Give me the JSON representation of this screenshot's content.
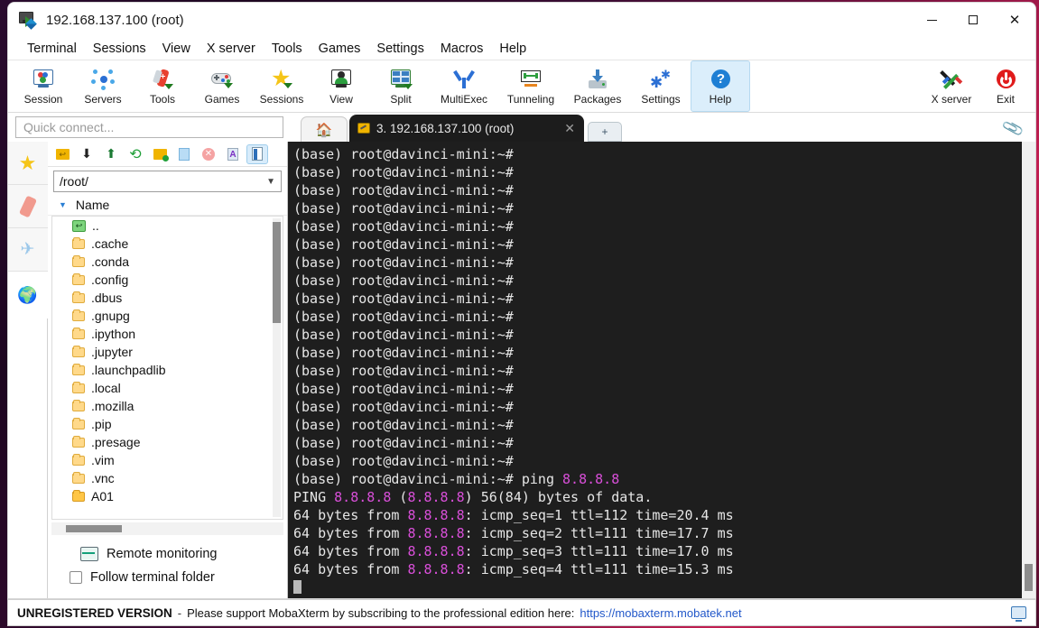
{
  "window": {
    "title": "192.168.137.100 (root)",
    "icon": "mobaxterm-icon",
    "controls": {
      "minimize": "–",
      "maximize": "□",
      "close": "✕"
    }
  },
  "menu": {
    "items": [
      "Terminal",
      "Sessions",
      "View",
      "X server",
      "Tools",
      "Games",
      "Settings",
      "Macros",
      "Help"
    ]
  },
  "toolbar": {
    "buttons": [
      {
        "label": "Session",
        "icon": "session-monitor-icon"
      },
      {
        "label": "Servers",
        "icon": "servers-network-icon"
      },
      {
        "label": "Tools",
        "icon": "tools-knife-icon"
      },
      {
        "label": "Games",
        "icon": "gamepad-icon"
      },
      {
        "label": "Sessions",
        "icon": "star-icon"
      },
      {
        "label": "View",
        "icon": "view-monitor-icon"
      },
      {
        "label": "Split",
        "icon": "split-screen-icon"
      },
      {
        "label": "MultiExec",
        "icon": "multiexec-fork-icon"
      },
      {
        "label": "Tunneling",
        "icon": "tunneling-icon"
      },
      {
        "label": "Packages",
        "icon": "packages-download-icon"
      },
      {
        "label": "Settings",
        "icon": "gear-icon"
      },
      {
        "label": "Help",
        "icon": "help-question-icon",
        "active": true
      }
    ],
    "right_buttons": [
      {
        "label": "X server",
        "icon": "x-server-icon"
      },
      {
        "label": "Exit",
        "icon": "power-exit-icon"
      }
    ]
  },
  "quick_connect": {
    "placeholder": "Quick connect..."
  },
  "tabs": {
    "home_icon": "home-icon",
    "active": {
      "label": "3. 192.168.137.100 (root)",
      "icon": "pencil-icon",
      "close": "✕"
    },
    "new_tab": "+",
    "clip_icon": "paperclip-icon"
  },
  "rail": {
    "items": [
      {
        "icon": "star-icon",
        "name": "sessions-rail"
      },
      {
        "icon": "tools-knife-icon",
        "name": "tools-rail"
      },
      {
        "icon": "paper-plane-icon",
        "name": "macros-rail"
      },
      {
        "icon": "globe-icon",
        "name": "sftp-globe-rail"
      }
    ]
  },
  "sftp": {
    "toolbar_icons": [
      "parent-folder-icon",
      "download-icon",
      "upload-icon",
      "refresh-icon",
      "new-folder-icon",
      "new-file-icon",
      "delete-icon",
      "text-mode-icon",
      "view-mode-icon"
    ],
    "path": "/root/",
    "path_chevron": "chevron-down-icon",
    "column_header": "Name",
    "sort_caret": "▼",
    "files": [
      {
        "name": "..",
        "type": "parent"
      },
      {
        "name": ".cache",
        "type": "folder"
      },
      {
        "name": ".conda",
        "type": "folder"
      },
      {
        "name": ".config",
        "type": "folder"
      },
      {
        "name": ".dbus",
        "type": "folder"
      },
      {
        "name": ".gnupg",
        "type": "folder"
      },
      {
        "name": ".ipython",
        "type": "folder"
      },
      {
        "name": ".jupyter",
        "type": "folder"
      },
      {
        "name": ".launchpadlib",
        "type": "folder"
      },
      {
        "name": ".local",
        "type": "folder"
      },
      {
        "name": ".mozilla",
        "type": "folder"
      },
      {
        "name": ".pip",
        "type": "folder"
      },
      {
        "name": ".presage",
        "type": "folder"
      },
      {
        "name": ".vim",
        "type": "folder"
      },
      {
        "name": ".vnc",
        "type": "folder"
      },
      {
        "name": "A01",
        "type": "folder-solid"
      }
    ],
    "remote_monitoring_label": "Remote monitoring",
    "follow_terminal_label": "Follow terminal folder",
    "follow_terminal_checked": false
  },
  "terminal": {
    "prompt": "(base) root@davinci-mini:~#",
    "blank_prompt_count": 18,
    "colors": {
      "background": "#1e1e1e",
      "foreground": "#e6e6e6",
      "ip_magenta": "#d94fd9"
    },
    "lines": [
      {
        "segments": [
          {
            "t": "(base) root@davinci-mini:~# ping ",
            "c": "def"
          },
          {
            "t": "8.8.8.8",
            "c": "ip"
          }
        ]
      },
      {
        "segments": [
          {
            "t": "PING ",
            "c": "def"
          },
          {
            "t": "8.8.8.8",
            "c": "ip"
          },
          {
            "t": " (",
            "c": "def"
          },
          {
            "t": "8.8.8.8",
            "c": "ip"
          },
          {
            "t": ") 56(84) bytes of data.",
            "c": "def"
          }
        ]
      },
      {
        "segments": [
          {
            "t": "64 bytes from ",
            "c": "def"
          },
          {
            "t": "8.8.8.8",
            "c": "ip"
          },
          {
            "t": ": icmp_seq=1 ttl=112 time=20.4 ms",
            "c": "def"
          }
        ]
      },
      {
        "segments": [
          {
            "t": "64 bytes from ",
            "c": "def"
          },
          {
            "t": "8.8.8.8",
            "c": "ip"
          },
          {
            "t": ": icmp_seq=2 ttl=111 time=17.7 ms",
            "c": "def"
          }
        ]
      },
      {
        "segments": [
          {
            "t": "64 bytes from ",
            "c": "def"
          },
          {
            "t": "8.8.8.8",
            "c": "ip"
          },
          {
            "t": ": icmp_seq=3 ttl=111 time=17.0 ms",
            "c": "def"
          }
        ]
      },
      {
        "segments": [
          {
            "t": "64 bytes from ",
            "c": "def"
          },
          {
            "t": "8.8.8.8",
            "c": "ip"
          },
          {
            "t": ": icmp_seq=4 ttl=111 time=15.3 ms",
            "c": "def"
          }
        ]
      }
    ]
  },
  "status_bar": {
    "unregistered": "UNREGISTERED VERSION",
    "dash": "-",
    "message": "Please support MobaXterm by subscribing to the professional edition here:",
    "link": "https://mobaxterm.mobatek.net",
    "monitor_icon": "display-icon"
  }
}
